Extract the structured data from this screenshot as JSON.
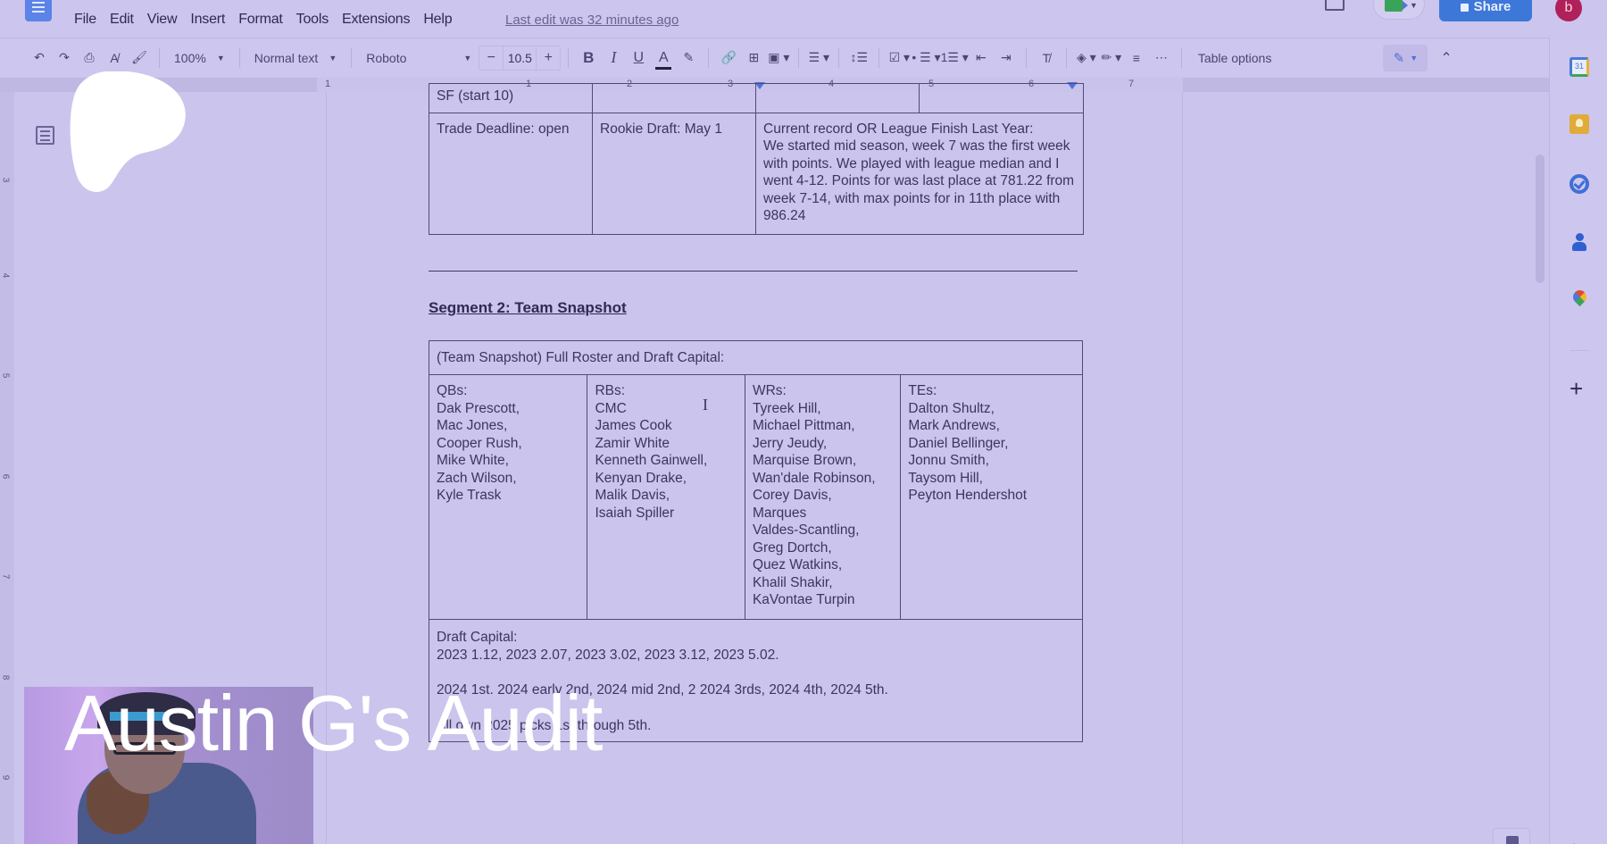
{
  "app": {
    "menu": [
      "File",
      "Edit",
      "View",
      "Insert",
      "Format",
      "Tools",
      "Extensions",
      "Help"
    ],
    "last_edit": "Last edit was 32 minutes ago",
    "share_label": "Share",
    "avatar_initial": "b"
  },
  "toolbar": {
    "zoom": "100%",
    "style": "Normal text",
    "font": "Roboto",
    "font_size": "10.5",
    "minus": "−",
    "plus": "+",
    "bold": "B",
    "italic": "I",
    "underline": "U",
    "text_color": "A",
    "table_options": "Table options",
    "text_color_value": "#24203d"
  },
  "ruler": {
    "horizontal_numbers": [
      "1",
      "1",
      "2",
      "3",
      "4",
      "5",
      "6",
      "7"
    ],
    "vertical_numbers": [
      "3",
      "4",
      "5",
      "6",
      "7",
      "8",
      "9"
    ]
  },
  "document": {
    "top_table": {
      "row1": [
        "SF (start 10)",
        "",
        "",
        ""
      ],
      "row2": {
        "trade_deadline": "Trade Deadline: open",
        "rookie_draft": "Rookie Draft: May 1",
        "record_heading": "Current record OR League Finish Last Year:",
        "record_text": "We started mid season, week 7 was the first week with points. We played with league median and I went 4-12. Points for was last place at 781.22 from week 7-14, with max points for in 11th place with 986.24"
      }
    },
    "segment_title": "Segment 2: Team Snapshot",
    "roster_table": {
      "header": "(Team Snapshot) Full Roster and Draft Capital:",
      "columns": [
        {
          "label": "QBs:",
          "players": [
            "Dak Prescott,",
            "Mac Jones,",
            "Cooper Rush,",
            "Mike White,",
            "Zach Wilson,",
            "Kyle Trask"
          ]
        },
        {
          "label": "RBs:",
          "players": [
            "CMC",
            "James Cook",
            "Zamir White",
            "Kenneth Gainwell,",
            "Kenyan Drake,",
            "Malik Davis,",
            "Isaiah Spiller"
          ]
        },
        {
          "label": "WRs:",
          "players": [
            "Tyreek Hill,",
            "Michael Pittman,",
            "Jerry Jeudy,",
            "Marquise Brown,",
            "Wan'dale Robinson,",
            "Corey Davis,",
            "Marques",
            "Valdes-Scantling,",
            "Greg Dortch,",
            "Quez Watkins,",
            "Khalil Shakir,",
            "KaVontae Turpin"
          ]
        },
        {
          "label": "TEs:",
          "players": [
            "Dalton Shultz,",
            "Mark Andrews,",
            "Daniel Bellinger,",
            "Jonnu Smith,",
            "Taysom Hill,",
            "Peyton Hendershot"
          ]
        }
      ],
      "draft_capital_label": "Draft Capital:",
      "draft_2023": "2023 1.12, 2023 2.07, 2023 3.02, 2023 3.12, 2023 5.02.",
      "draft_2024": "2024 1st. 2024 early 2nd, 2024 mid 2nd, 2 2024 3rds, 2024 4th, 2024 5th.",
      "draft_2025": "All own 2025 picks 1st through 5th."
    }
  },
  "side_panel": {
    "calendar_day": "31",
    "add_label": "+"
  },
  "overlay": {
    "title": "Austin G's Audit"
  },
  "colors": {
    "tint": "#cbc4ec",
    "share_button": "#3d78d9",
    "avatar": "#b0205a"
  }
}
